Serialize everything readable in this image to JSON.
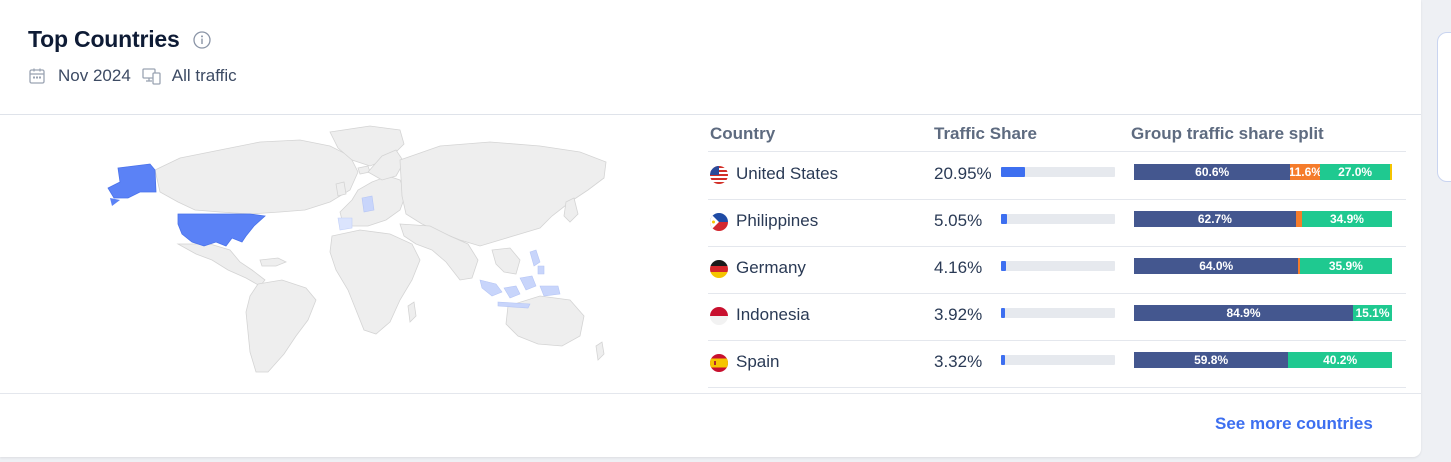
{
  "widget": {
    "title": "Top Countries",
    "date": "Nov 2024",
    "traffic_filter": "All traffic",
    "see_more_label": "See more countries"
  },
  "table": {
    "columns": [
      "Country",
      "Traffic Share",
      "Group traffic share split"
    ],
    "rows": [
      {
        "country": "United States",
        "flag": "us-flag-icon",
        "share": "20.95%",
        "share_value": 20.95,
        "split": [
          {
            "value": 60.6,
            "label": "60.6%",
            "color": "#44578f"
          },
          {
            "value": 11.6,
            "label": "11.6%",
            "color": "#f57c2b"
          },
          {
            "value": 27.0,
            "label": "27.0%",
            "color": "#1fc990"
          },
          {
            "value": 0.8,
            "label": "",
            "color": "#f5c400"
          }
        ]
      },
      {
        "country": "Philippines",
        "flag": "ph-flag-icon",
        "share": "5.05%",
        "share_value": 5.05,
        "split": [
          {
            "value": 62.7,
            "label": "62.7%",
            "color": "#44578f"
          },
          {
            "value": 2.4,
            "label": "",
            "color": "#f57c2b"
          },
          {
            "value": 34.9,
            "label": "34.9%",
            "color": "#1fc990"
          }
        ]
      },
      {
        "country": "Germany",
        "flag": "de-flag-icon",
        "share": "4.16%",
        "share_value": 4.16,
        "split": [
          {
            "value": 64.0,
            "label": "64.0%",
            "color": "#44578f"
          },
          {
            "value": 0.5,
            "label": "",
            "color": "#f57c2b"
          },
          {
            "value": 35.9,
            "label": "35.9%",
            "color": "#1fc990"
          }
        ]
      },
      {
        "country": "Indonesia",
        "flag": "id-flag-icon",
        "share": "3.92%",
        "share_value": 3.92,
        "split": [
          {
            "value": 84.9,
            "label": "84.9%",
            "color": "#44578f"
          },
          {
            "value": 15.1,
            "label": "15.1%",
            "color": "#1fc990"
          }
        ]
      },
      {
        "country": "Spain",
        "flag": "es-flag-icon",
        "share": "3.32%",
        "share_value": 3.32,
        "split": [
          {
            "value": 59.8,
            "label": "59.8%",
            "color": "#44578f"
          },
          {
            "value": 40.2,
            "label": "40.2%",
            "color": "#1fc990"
          }
        ]
      }
    ]
  },
  "colors": {
    "accent": "#3d6ff0",
    "split_primary": "#44578f",
    "split_secondary": "#f57c2b",
    "split_tertiary": "#1fc990",
    "split_other": "#f5c400",
    "map_highlight": "#5b82f6",
    "map_base": "#eeeeee"
  }
}
